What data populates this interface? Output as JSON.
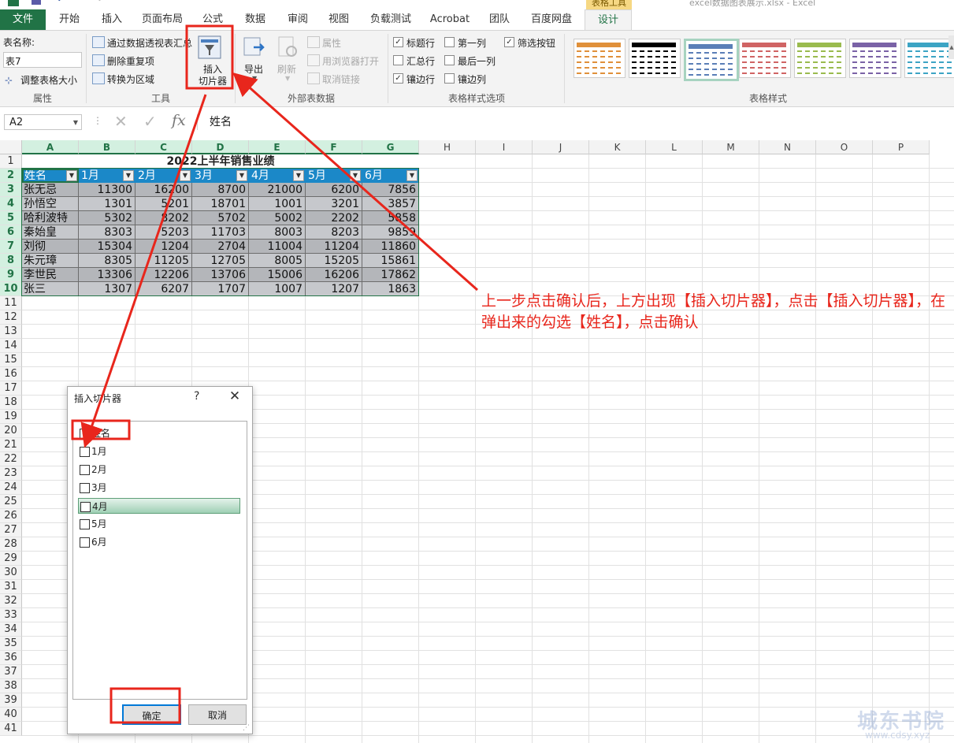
{
  "titlebar": {
    "document_title": "excel数据图表展示.xlsx - Excel",
    "context_tab_group": "表格工具"
  },
  "ribbon_tabs": [
    "文件",
    "开始",
    "插入",
    "页面布局",
    "公式",
    "数据",
    "审阅",
    "视图",
    "负载测试",
    "Acrobat",
    "团队",
    "百度网盘",
    "设计"
  ],
  "active_tab": "设计",
  "ribbon": {
    "properties": {
      "table_name_label": "表名称:",
      "table_name_value": "表7",
      "resize_label": "调整表格大小",
      "group_label": "属性"
    },
    "tools": {
      "pivot_label": "通过数据透视表汇总",
      "remove_dup_label": "删除重复项",
      "convert_label": "转换为区域",
      "slicer_label_1": "插入",
      "slicer_label_2": "切片器",
      "group_label": "工具"
    },
    "external": {
      "export_label": "导出",
      "refresh_label": "刷新",
      "props_label": "属性",
      "open_browser_label": "用浏览器打开",
      "unlink_label": "取消链接",
      "group_label": "外部表数据"
    },
    "style_options": {
      "items": [
        {
          "label": "标题行",
          "checked": true
        },
        {
          "label": "第一列",
          "checked": false
        },
        {
          "label": "筛选按钮",
          "checked": true
        },
        {
          "label": "汇总行",
          "checked": false
        },
        {
          "label": "最后一列",
          "checked": false
        },
        {
          "label": "镶边行",
          "checked": true
        },
        {
          "label": "镶边列",
          "checked": false
        }
      ],
      "group_label": "表格样式选项"
    },
    "table_styles": {
      "group_label": "表格样式",
      "colors": [
        "#e0903a",
        "#000000",
        "#5b7fb7",
        "#d06464",
        "#9abb4e",
        "#7a62a6",
        "#3ca4c4"
      ],
      "selected_index": 2
    }
  },
  "formula_bar": {
    "name_box": "A2",
    "fx_icon": "fx",
    "content": "姓名"
  },
  "grid": {
    "columns": [
      "A",
      "B",
      "C",
      "D",
      "E",
      "F",
      "G",
      "H",
      "I",
      "J",
      "K",
      "L",
      "M",
      "N",
      "O",
      "P"
    ],
    "rows": [
      "1",
      "2",
      "3",
      "4",
      "5",
      "6",
      "7",
      "8",
      "9",
      "10",
      "11",
      "12",
      "13",
      "14",
      "15",
      "16",
      "17",
      "18",
      "19",
      "20",
      "21",
      "22",
      "23",
      "24",
      "25",
      "26",
      "27",
      "28",
      "29",
      "30",
      "31",
      "32",
      "33",
      "34",
      "35",
      "36",
      "37",
      "38",
      "39",
      "40",
      "41"
    ]
  },
  "table": {
    "title": "2022上半年销售业绩",
    "headers": [
      "姓名",
      "1月",
      "2月",
      "3月",
      "4月",
      "5月",
      "6月"
    ],
    "rows": [
      [
        "张无忌",
        "11300",
        "16200",
        "8700",
        "21000",
        "6200",
        "7856"
      ],
      [
        "孙悟空",
        "1301",
        "5201",
        "18701",
        "1001",
        "3201",
        "3857"
      ],
      [
        "哈利波特",
        "5302",
        "8202",
        "5702",
        "5002",
        "2202",
        "5858"
      ],
      [
        "秦始皇",
        "8303",
        "5203",
        "11703",
        "8003",
        "8203",
        "9859"
      ],
      [
        "刘彻",
        "15304",
        "1204",
        "2704",
        "11004",
        "11204",
        "11860"
      ],
      [
        "朱元璋",
        "8305",
        "11205",
        "12705",
        "8005",
        "15205",
        "15861"
      ],
      [
        "李世民",
        "13306",
        "12206",
        "13706",
        "15006",
        "16206",
        "17862"
      ],
      [
        "张三",
        "1307",
        "6207",
        "1707",
        "1007",
        "1207",
        "1863"
      ]
    ]
  },
  "annotation": "上一步点击确认后，上方出现【插入切片器】，点击【插入切片器】，在弹出来的勾选【姓名】，点击确认",
  "dialog": {
    "title": "插入切片器",
    "help": "?",
    "close": "✕",
    "options": [
      {
        "label": "姓名",
        "checked": true
      },
      {
        "label": "1月",
        "checked": false
      },
      {
        "label": "2月",
        "checked": false
      },
      {
        "label": "3月",
        "checked": false
      },
      {
        "label": "4月",
        "checked": false
      },
      {
        "label": "5月",
        "checked": false
      },
      {
        "label": "6月",
        "checked": false
      }
    ],
    "highlighted_option": "4月",
    "ok_label": "确定",
    "cancel_label": "取消"
  },
  "watermark": {
    "line1": "城东书院",
    "line2": "www.cdsy.xyz"
  },
  "accent_color": "#217346",
  "annotation_color": "#e8261c"
}
